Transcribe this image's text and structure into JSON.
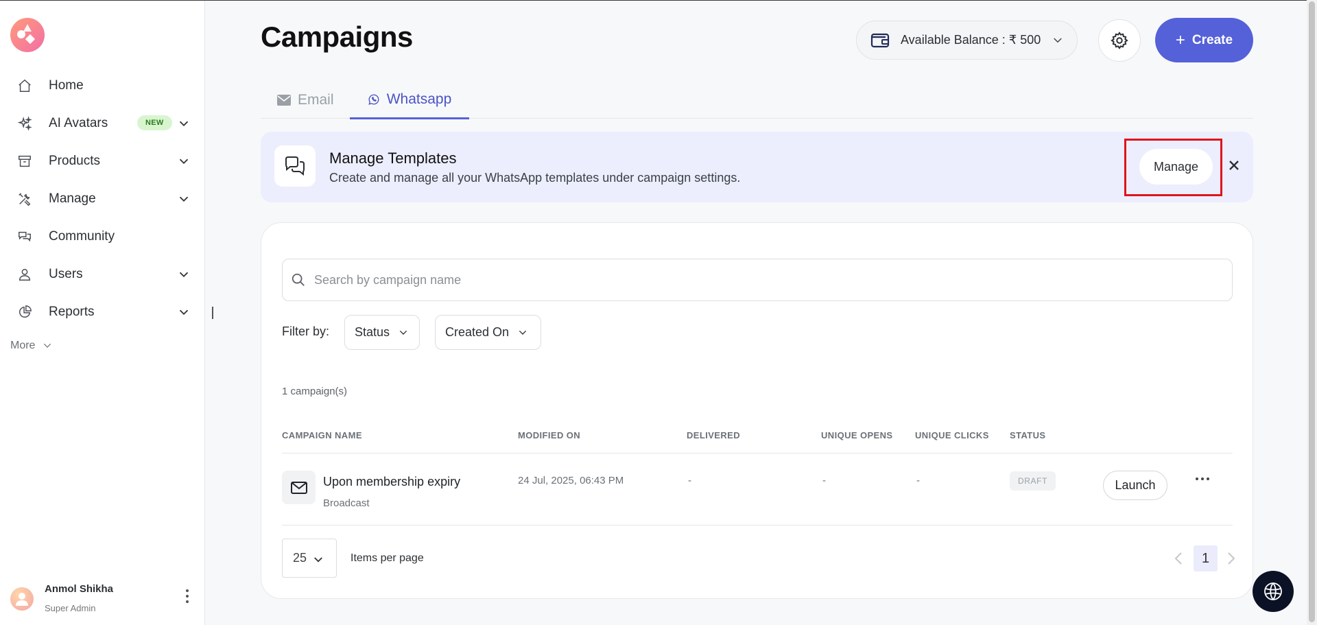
{
  "sidebar": {
    "items": [
      {
        "label": "Home",
        "icon": "home-icon",
        "has_chevron": false
      },
      {
        "label": "AI Avatars",
        "icon": "sparkles-icon",
        "badge": "NEW",
        "has_chevron": true
      },
      {
        "label": "Products",
        "icon": "archive-box-icon",
        "has_chevron": true
      },
      {
        "label": "Manage",
        "icon": "tools-icon",
        "has_chevron": true
      },
      {
        "label": "Community",
        "icon": "chat-bubbles-icon",
        "has_chevron": false
      },
      {
        "label": "Users",
        "icon": "user-icon",
        "has_chevron": true
      },
      {
        "label": "Reports",
        "icon": "pie-chart-icon",
        "has_chevron": true
      }
    ],
    "more_label": "More",
    "user": {
      "name": "Anmol Shikha",
      "role": "Super Admin"
    }
  },
  "header": {
    "title": "Campaigns",
    "balance_label": "Available Balance : ₹ 500",
    "create_label": "Create"
  },
  "tabs": [
    {
      "label": "Email",
      "active": false
    },
    {
      "label": "Whatsapp",
      "active": true
    }
  ],
  "banner": {
    "title": "Manage Templates",
    "subtitle": "Create and manage all your WhatsApp templates under campaign settings.",
    "button_label": "Manage"
  },
  "search": {
    "placeholder": "Search by campaign name",
    "value": ""
  },
  "filters": {
    "label": "Filter by:",
    "status_label": "Status",
    "created_label": "Created On"
  },
  "table": {
    "count_text": "1 campaign(s)",
    "columns": [
      "CAMPAIGN NAME",
      "MODIFIED ON",
      "DELIVERED",
      "UNIQUE OPENS",
      "UNIQUE CLICKS",
      "STATUS"
    ],
    "rows": [
      {
        "name": "Upon membership expiry",
        "type": "Broadcast",
        "modified": "24 Jul, 2025, 06:43 PM",
        "delivered": "-",
        "opens": "-",
        "clicks": "-",
        "status": "DRAFT",
        "action_label": "Launch"
      }
    ]
  },
  "pagination": {
    "per_page": "25",
    "per_page_label": "Items per page",
    "current_page": "1"
  },
  "colors": {
    "accent": "#5561d8",
    "banner_bg": "#eceefd",
    "highlight": "#e0131b"
  }
}
